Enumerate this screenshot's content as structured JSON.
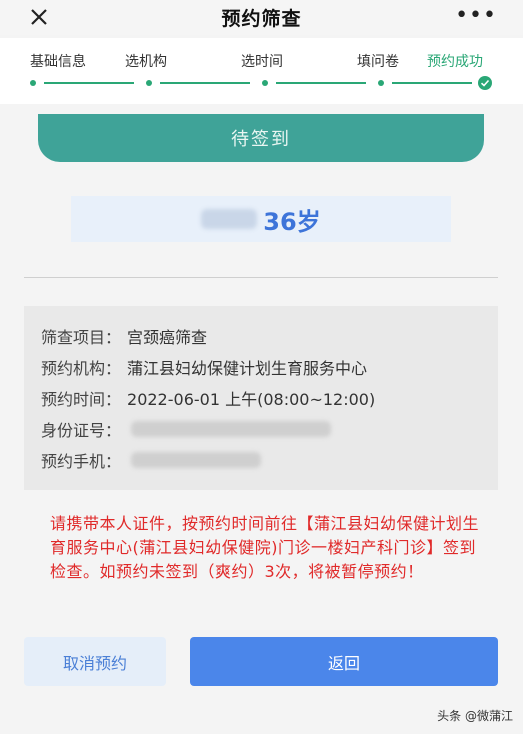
{
  "header": {
    "title": "预约筛查",
    "more_icon": "more-icon",
    "close_icon": "close-icon"
  },
  "steps": [
    {
      "label": "基础信息"
    },
    {
      "label": "选机构"
    },
    {
      "label": "选时间"
    },
    {
      "label": "填问卷"
    },
    {
      "label": "预约成功"
    }
  ],
  "status": {
    "label": "待签到"
  },
  "person": {
    "age": "36岁"
  },
  "details": {
    "project_label": "筛查项目：",
    "project_value": "宫颈癌筛查",
    "org_label": "预约机构：",
    "org_value": "蒲江县妇幼保健计划生育服务中心",
    "time_label": "预约时间：",
    "time_value": "2022-06-01 上午(08:00~12:00)",
    "id_label": "身份证号：",
    "phone_label": "预约手机："
  },
  "notice": "请携带本人证件，按预约时间前往【蒲江县妇幼保健计划生育服务中心(蒲江县妇幼保健院)门诊一楼妇产科门诊】签到检查。如预约未签到（爽约）3次，将被暂停预约！",
  "actions": {
    "cancel_label": "取消预约",
    "back_label": "返回"
  },
  "watermark": "头条 @微蒲江",
  "colors": {
    "accent_green": "#2aa776",
    "status_teal": "#3fa398",
    "primary_blue": "#4b86ea",
    "notice_red": "#e02a2a"
  }
}
